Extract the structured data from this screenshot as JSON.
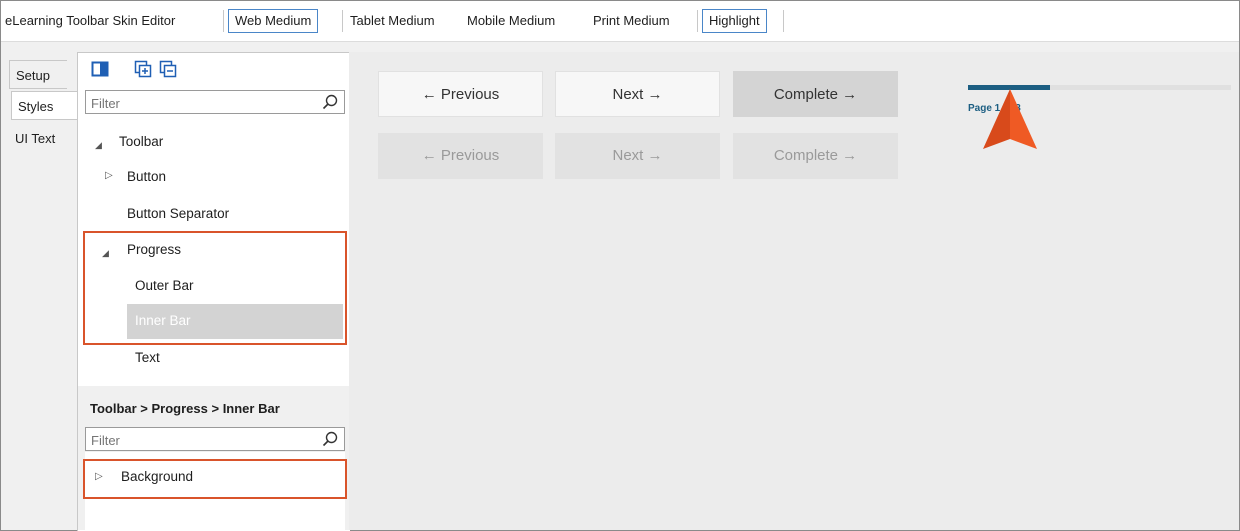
{
  "toolbar": {
    "title": "eLearning Toolbar Skin Editor",
    "mediums": [
      "Web Medium",
      "Tablet Medium",
      "Mobile Medium",
      "Print Medium"
    ],
    "highlight": "Highlight"
  },
  "side_tabs": [
    "Setup",
    "Styles",
    "UI Text"
  ],
  "filter_placeholder": "Filter",
  "tree": {
    "toolbar": "Toolbar",
    "button": "Button",
    "button_separator": "Button Separator",
    "progress": "Progress",
    "outer_bar": "Outer Bar",
    "inner_bar": "Inner Bar",
    "text": "Text"
  },
  "breadcrumb": "Toolbar > Progress > Inner Bar",
  "properties": {
    "background": "Background"
  },
  "preview": {
    "buttons_row1": [
      "← Previous",
      "Next →",
      "Complete →"
    ],
    "buttons_row2": [
      "← Previous",
      "Next →",
      "Complete →"
    ],
    "progress_text": "Page 1 of 3",
    "progress_fraction": 0.31
  },
  "colors": {
    "highlight_border": "#d9542b",
    "selection_bg": "#d3d3d3",
    "progress_inner": "#1c5e82",
    "pointer": "#ef5a24",
    "tab_box": "#4a86c8"
  }
}
